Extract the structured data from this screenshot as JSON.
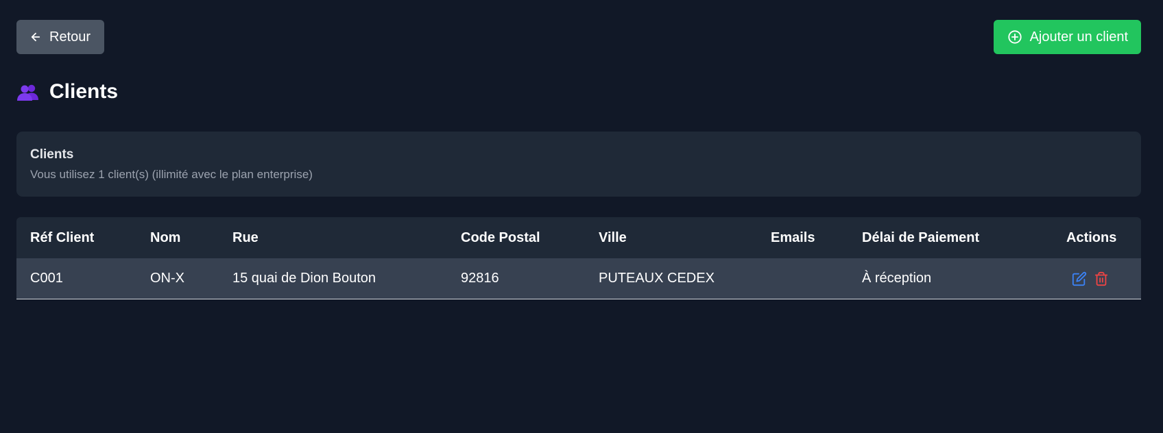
{
  "toolbar": {
    "back_label": "Retour",
    "add_label": "Ajouter un client"
  },
  "page": {
    "title": "Clients",
    "title_icon": "people-icon"
  },
  "info": {
    "title": "Clients",
    "subtitle": "Vous utilisez 1 client(s) (illimité avec le plan enterprise)"
  },
  "table": {
    "headers": [
      "Réf Client",
      "Nom",
      "Rue",
      "Code Postal",
      "Ville",
      "Emails",
      "Délai de Paiement",
      "Actions"
    ],
    "rows": [
      {
        "ref": "C001",
        "nom": "ON-X",
        "rue": "15 quai de Dion Bouton",
        "code_postal": "92816",
        "ville": "PUTEAUX CEDEX",
        "emails": "",
        "delai": "À réception"
      }
    ]
  },
  "colors": {
    "background": "#111827",
    "card": "#1f2937",
    "row": "#374151",
    "accent_green": "#22c55e",
    "edit_blue": "#3b82f6",
    "delete_red": "#ef4444"
  }
}
